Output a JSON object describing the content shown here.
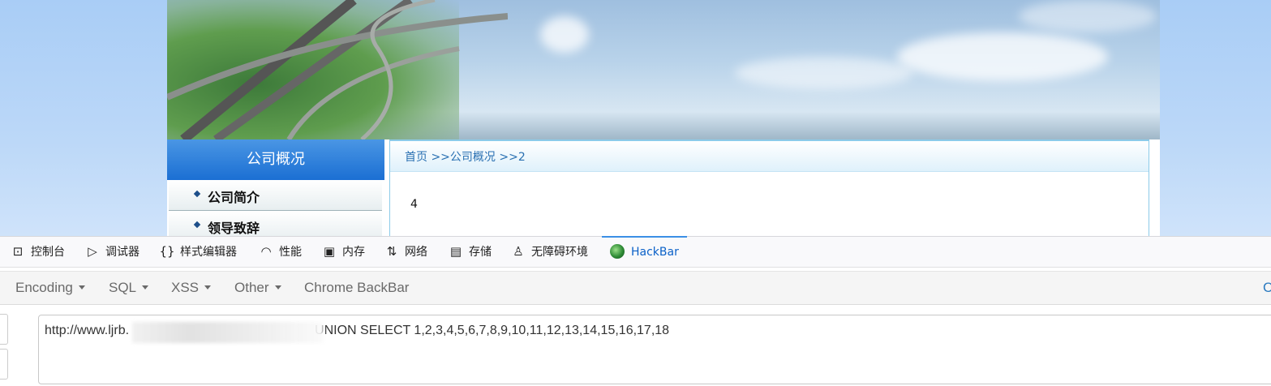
{
  "page": {
    "sidebar": {
      "title": "公司概况",
      "items": [
        {
          "label": "公司简介"
        },
        {
          "label": "领导致辞"
        }
      ]
    },
    "breadcrumb": "首页 >>公司概况 >>2",
    "content_value": "4"
  },
  "devtools": {
    "tabs": [
      {
        "label": "控制台",
        "icon": "console-icon"
      },
      {
        "label": "调试器",
        "icon": "debugger-icon"
      },
      {
        "label": "样式编辑器",
        "icon": "style-editor-icon"
      },
      {
        "label": "性能",
        "icon": "performance-icon"
      },
      {
        "label": "内存",
        "icon": "memory-icon"
      },
      {
        "label": "网络",
        "icon": "network-icon"
      },
      {
        "label": "存储",
        "icon": "storage-icon"
      },
      {
        "label": "无障碍环境",
        "icon": "accessibility-icon"
      },
      {
        "label": "HackBar",
        "icon": "hackbar-logo-icon",
        "active": true
      }
    ]
  },
  "hackbar": {
    "menus": [
      {
        "label": "Encoding"
      },
      {
        "label": "SQL"
      },
      {
        "label": "XSS"
      },
      {
        "label": "Other"
      }
    ],
    "backbar_label": "Chrome BackBar",
    "right_label": "C",
    "url_visible_start": "http://www.ljrb.",
    "url_visible_end": "UNION SELECT 1,2,3,4,5,6,7,8,9,10,11,12,13,14,15,16,17,18"
  },
  "colors": {
    "accent": "#0b61c8",
    "sidebar_header": "#1b6fd3",
    "breadcrumb": "#2a70b2"
  }
}
